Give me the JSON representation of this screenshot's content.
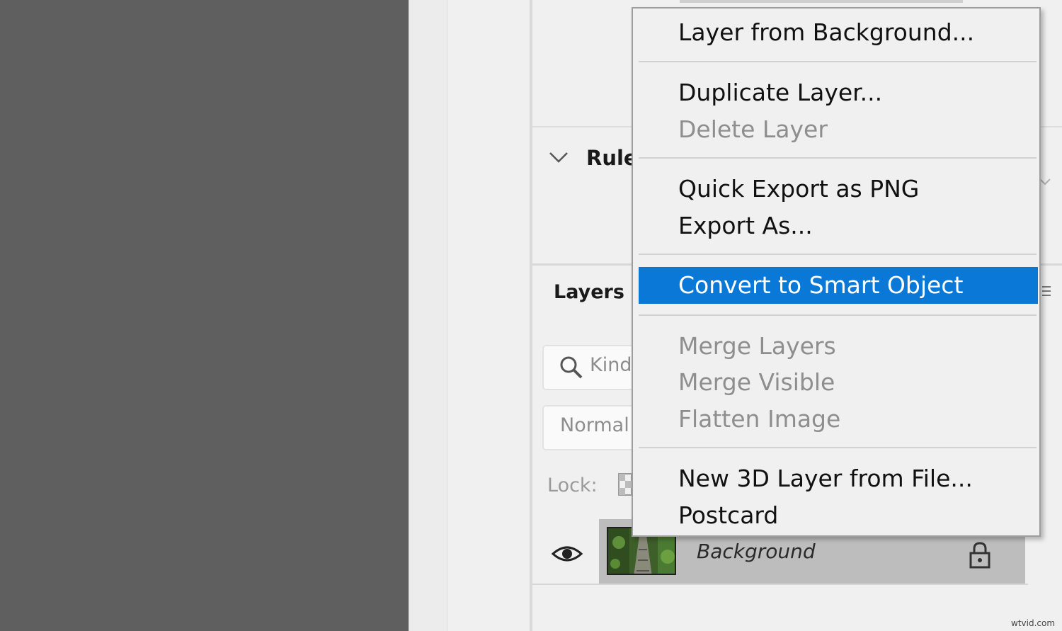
{
  "panels": {
    "rulers_title": "Rule",
    "layers_tab": "Layers",
    "search_placeholder": "Kind",
    "blend_mode": "Normal",
    "lock_label": "Lock:",
    "layer_name": "Background"
  },
  "context_menu": {
    "items": [
      {
        "label": "Layer from Background...",
        "disabled": false
      },
      {
        "label": "Duplicate Layer...",
        "disabled": false
      },
      {
        "label": "Delete Layer",
        "disabled": true
      },
      {
        "label": "Quick Export as PNG",
        "disabled": false
      },
      {
        "label": "Export As...",
        "disabled": false
      },
      {
        "label": "Convert to Smart Object",
        "disabled": false,
        "highlighted": true
      },
      {
        "label": "Merge Layers",
        "disabled": true
      },
      {
        "label": "Merge Visible",
        "disabled": true
      },
      {
        "label": "Flatten Image",
        "disabled": true
      },
      {
        "label": "New 3D Layer from File...",
        "disabled": false
      },
      {
        "label": "Postcard",
        "disabled": false
      }
    ]
  },
  "watermark": "wtvid.com",
  "colors": {
    "highlight": "#0a78d7",
    "canvas": "#5f5f5f",
    "panel": "#f0f0f0"
  },
  "icons": [
    "chevron-down-icon",
    "search-icon",
    "eye-icon",
    "lock-icon",
    "panel-menu-icon",
    "lock-transparent-icon"
  ]
}
